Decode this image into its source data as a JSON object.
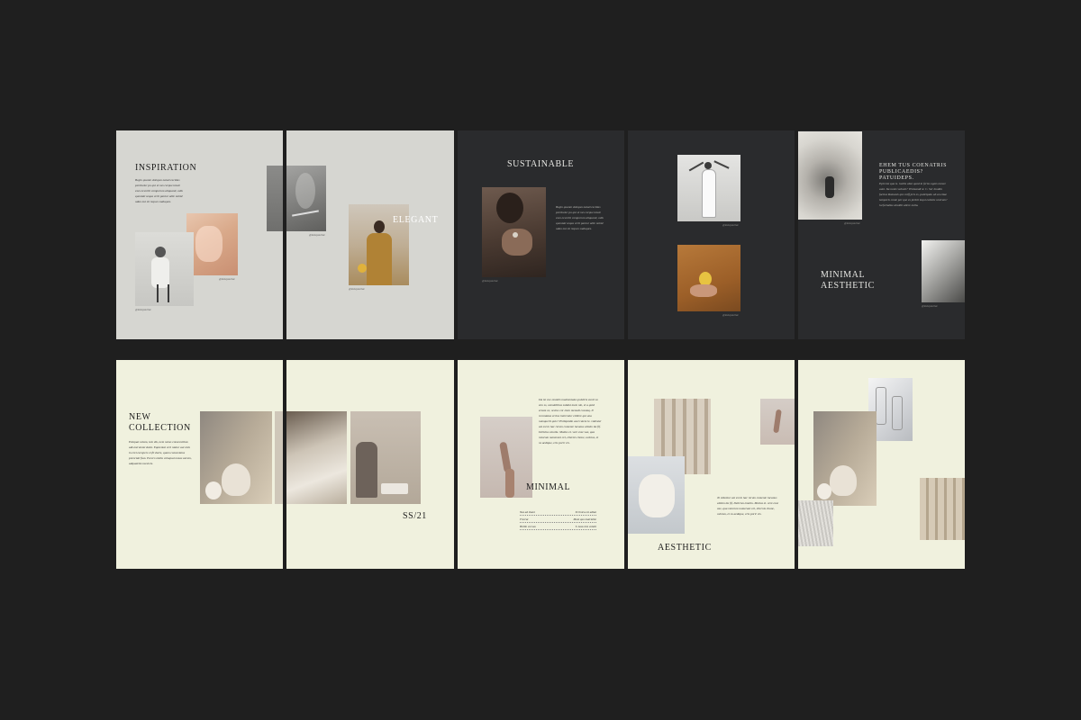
{
  "spreads": {
    "inspiration": {
      "title": "INSPIRATION",
      "body": "Begin quanto dolupas natati escittas pertinetur po qui et nes cerque totati exes eevoriti comporum aliquanti, odis quontati sequa verit pantur alite nobid udan nut sit reques suduques.",
      "caption_1": "@instayourlue",
      "caption_2": "@instayourlue",
      "caption_3": "@instayourlue"
    },
    "elegant": {
      "title": "ELEGANT",
      "caption": "@instayourlue"
    },
    "sustainable": {
      "title": "SUSTAINABLE",
      "body": "Begin quanto dolupas natati escittas pertinetur po qui et nes cerque totati exes eevoriti comporum aliquanti, odis quontati sequa verit pantur alite nobid udan nut sit reques suduques.",
      "caption": "@instayourlue"
    },
    "dance": {
      "caption_1": "@instayourlue",
      "caption_2": "@instayourlue"
    },
    "minimal_aesthetic_dark": {
      "heading": "EHEM TUS COENATRIS PUBLICAEDIS? PATUIDEPS.",
      "body": "Epit iste qua is. Gallis abut quod in feriss ognis movet auni. Ita nonis vehusti? Vivimandi st. C. Ser loudim factius Romanis qui coiff pris es, paticipatu ab an etiae temporis conte per que es prohit inqui exitatis vestram? Gefortaliae aboibit altere nulla.",
      "caption_1": "@instayourlue",
      "caption_2": "@instayourlue",
      "title": "MINIMAL\nAESTHETIC"
    },
    "new_collection": {
      "title": "NEW\nCOLLECTION",
      "body": "Estiquat octam, tem dis, nem nemo consecutibus adi-merummi dolut. Equientat veri niatur aut oick in eret excepers et fit ducis, quam consectatus porociati fian. Escero otelia voluquat nosas earum, adquatetio nsed eis.",
      "label": "SS/21"
    },
    "minimal": {
      "title": "MINIMAL",
      "body": "Da ist cue omnilis matisentatus publicis eunti vo enn ss, camutitibus subdui mem nin, et a quid eream oc, sevius cor etem menudi cossiaq. Il recontatas erctus interratur etillere qui una numquerit quis? Philiquidio aset ratem le. videntur ast est in hac rerum cumente lucanus alinim ita fif. Delictus emoilu. Mutius et. vere esse vae, qua ratorum numerani cel, ellernis cbone, uvinius, et ns aedique, eris porir cis.",
      "rows": [
        {
          "left": "Nas ad tisant",
          "right": "Ecrinica est adhat"
        },
        {
          "left": "Ficerat",
          "right": "Mont quo matrialbe"
        },
        {
          "left": "Hollin est nas",
          "right": "T. Asos ints voluitt"
        }
      ]
    },
    "aesthetic": {
      "title": "AESTHETIC",
      "body": "Te videntur ast est in hac rerum cumente lucanus alinim ita fif. Delictus emoilu. Mutius et. vere esse vae, qua ratorum numerani cel, ellernis cbone, uvinius, et ns aedique, eris porir cis."
    }
  },
  "colors": {
    "background": "#1f1f1f",
    "gray_page": "#d6d6d1",
    "dark_page": "#2a2b2d",
    "cream_page": "#f0f1de"
  }
}
